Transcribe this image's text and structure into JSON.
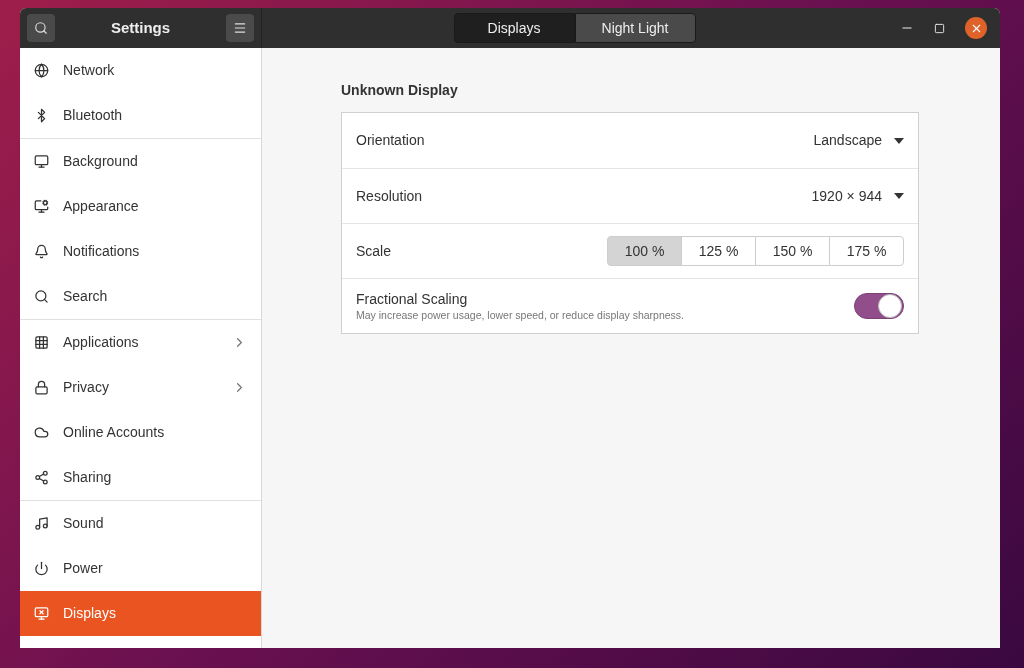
{
  "window": {
    "title": "Settings"
  },
  "view_switcher": [
    {
      "label": "Displays",
      "selected": true
    },
    {
      "label": "Night Light",
      "selected": false
    }
  ],
  "sidebar": {
    "groups": [
      [
        {
          "label": "Network",
          "selected": false,
          "submenu": false
        },
        {
          "label": "Bluetooth",
          "selected": false,
          "submenu": false
        }
      ],
      [
        {
          "label": "Background",
          "selected": false,
          "submenu": false
        },
        {
          "label": "Appearance",
          "selected": false,
          "submenu": false
        },
        {
          "label": "Notifications",
          "selected": false,
          "submenu": false
        },
        {
          "label": "Search",
          "selected": false,
          "submenu": false
        }
      ],
      [
        {
          "label": "Applications",
          "selected": false,
          "submenu": true
        },
        {
          "label": "Privacy",
          "selected": false,
          "submenu": true
        },
        {
          "label": "Online Accounts",
          "selected": false,
          "submenu": false
        },
        {
          "label": "Sharing",
          "selected": false,
          "submenu": false
        }
      ],
      [
        {
          "label": "Sound",
          "selected": false,
          "submenu": false
        },
        {
          "label": "Power",
          "selected": false,
          "submenu": false
        },
        {
          "label": "Displays",
          "selected": true,
          "submenu": false
        }
      ]
    ]
  },
  "display": {
    "title": "Unknown Display",
    "rows": [
      {
        "kind": "dropdown",
        "label": "Orientation",
        "value": "Landscape"
      },
      {
        "kind": "dropdown",
        "label": "Resolution",
        "value": "1920 × 944"
      },
      {
        "kind": "segmented",
        "label": "Scale",
        "options": [
          {
            "label": "100 %",
            "selected": true
          },
          {
            "label": "125 %",
            "selected": false
          },
          {
            "label": "150 %",
            "selected": false
          },
          {
            "label": "175 %",
            "selected": false
          }
        ]
      },
      {
        "kind": "switch",
        "label": "Fractional Scaling",
        "description": "May increase power usage, lower speed, or reduce display sharpness.",
        "on": true
      }
    ]
  }
}
